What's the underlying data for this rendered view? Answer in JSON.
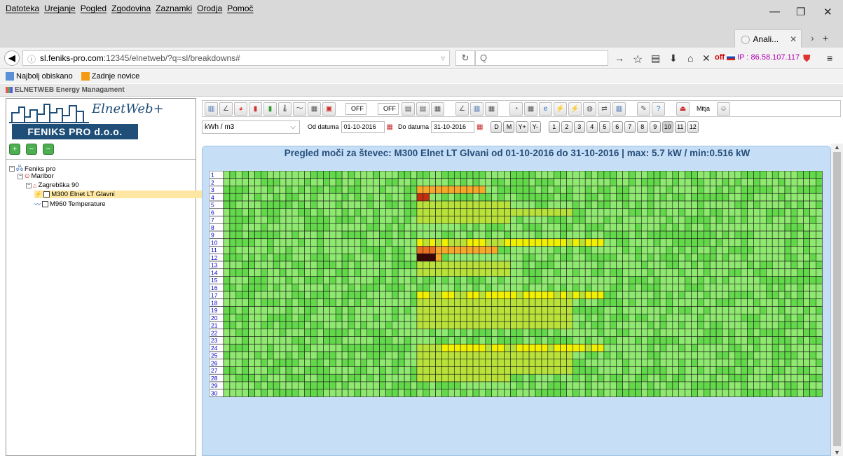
{
  "browser": {
    "menu": [
      "Datoteka",
      "Urejanje",
      "Pogled",
      "Zgodovina",
      "Zaznamki",
      "Orodja",
      "Pomoč"
    ],
    "tab_title": "Anali...",
    "url_host": "sl.feniks-pro.com",
    "url_rest": ":12345/elnetweb/?q=sl/breakdowns#",
    "search_placeholder": "Q",
    "off_label": "off",
    "ip_label": "IP : 86.58.107.117",
    "bookmarks": [
      "Najbolj obiskano",
      "Zadnje novice"
    ]
  },
  "app": {
    "header": "ELNETWEB Energy Managament",
    "logo_script": "ElnetWeb+",
    "logo_text": "FENIKS PRO d.o.o.",
    "tree": [
      {
        "label": "Feniks pro",
        "level": 0
      },
      {
        "label": "Maribor",
        "level": 1
      },
      {
        "label": "Zagrebška 90",
        "level": 2
      },
      {
        "label": "M300 Elnet LT Glavni",
        "level": 3,
        "selected": true
      },
      {
        "label": "M960 Temperature",
        "level": 3
      }
    ],
    "toolbar": {
      "off1": "OFF",
      "off2": "OFF",
      "user": "Mitja",
      "unit": "kWh / m3",
      "from_label": "Od datuma",
      "from_date": "01-10-2016",
      "to_label": "Do datuma",
      "to_date": "31-10-2016",
      "range_btns": [
        "D",
        "M",
        "Y+",
        "Y-"
      ],
      "month_btns": [
        "1",
        "2",
        "3",
        "4",
        "5",
        "6",
        "7",
        "8",
        "9",
        "10",
        "11",
        "12"
      ],
      "active_month": "10"
    },
    "heatmap_title": "Pregled moči za števec: M300 Elnet LT Glvani od 01-10-2016 do 31-10-2016   |  max: 5.7 kW / min:0.516 kW"
  },
  "heatmap": {
    "row_labels": [
      "1",
      "2",
      "3",
      "4",
      "5",
      "6",
      "7",
      "8",
      "9",
      "10",
      "11",
      "12",
      "13",
      "14",
      "15",
      "16",
      "17",
      "18",
      "19",
      "20",
      "21",
      "22",
      "23",
      "24",
      "25",
      "26",
      "27",
      "28",
      "29",
      "30"
    ],
    "hours_per_row": 96,
    "colors": [
      "#8fe870",
      "#63d84a",
      "#b8e23a",
      "#f0f000",
      "#f6a82a",
      "#e87020",
      "#c03010",
      "#3a0505"
    ],
    "active_segments": [
      {
        "rows": [
          3
        ],
        "from": 31,
        "to": 41,
        "level": 4
      },
      {
        "rows": [
          4
        ],
        "from": 31,
        "to": 32,
        "level": 6
      },
      {
        "rows": [
          10,
          17,
          24
        ],
        "from": 31,
        "to": 60,
        "level": 3
      },
      {
        "rows": [
          11
        ],
        "from": 31,
        "to": 43,
        "level": 5
      },
      {
        "rows": [
          12
        ],
        "from": 31,
        "to": 34,
        "level": 7
      },
      {
        "rows": [
          6,
          18,
          19,
          20,
          21,
          25,
          26,
          27
        ],
        "from": 31,
        "to": 55,
        "level": 2
      },
      {
        "rows": [
          5,
          7,
          13,
          14,
          28
        ],
        "from": 31,
        "to": 45,
        "level": 2
      }
    ]
  }
}
